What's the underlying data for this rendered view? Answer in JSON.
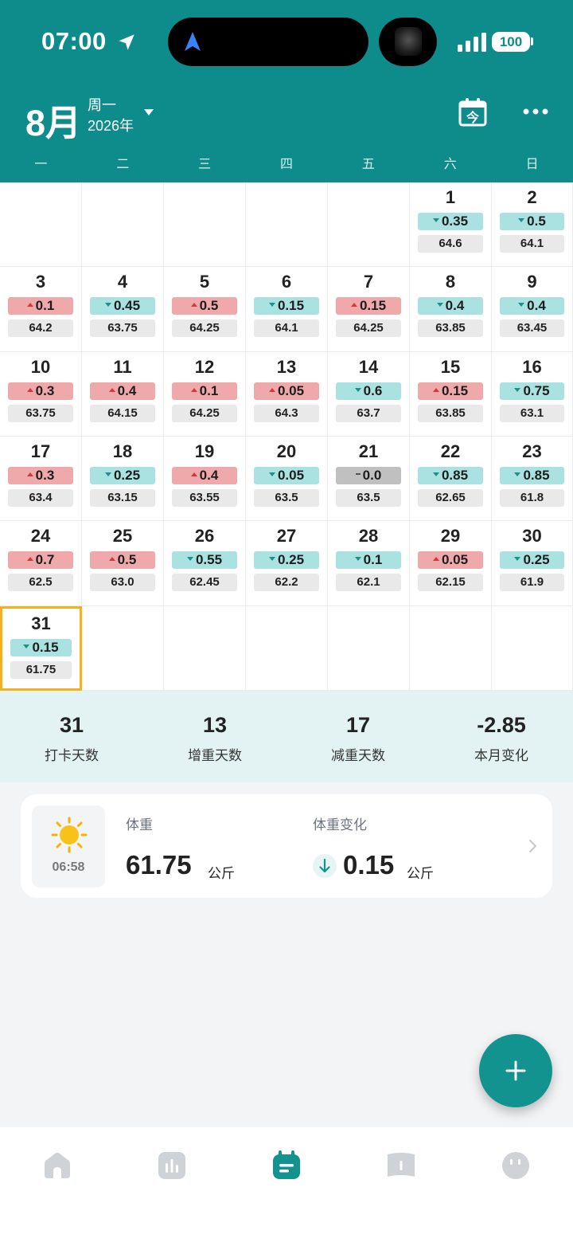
{
  "status_bar": {
    "time": "07:00",
    "battery": "100"
  },
  "header": {
    "month": "8月",
    "weekday": "周一",
    "year": "2026年",
    "weekdays": [
      "一",
      "二",
      "三",
      "四",
      "五",
      "六",
      "日"
    ]
  },
  "calendar": {
    "days": [
      {
        "day": "1",
        "change": "0.35",
        "dir": "down",
        "weight": "64.6"
      },
      {
        "day": "2",
        "change": "0.5",
        "dir": "down",
        "weight": "64.1"
      },
      {
        "day": "3",
        "change": "0.1",
        "dir": "up",
        "weight": "64.2"
      },
      {
        "day": "4",
        "change": "0.45",
        "dir": "down",
        "weight": "63.75"
      },
      {
        "day": "5",
        "change": "0.5",
        "dir": "up",
        "weight": "64.25"
      },
      {
        "day": "6",
        "change": "0.15",
        "dir": "down",
        "weight": "64.1"
      },
      {
        "day": "7",
        "change": "0.15",
        "dir": "up",
        "weight": "64.25"
      },
      {
        "day": "8",
        "change": "0.4",
        "dir": "down",
        "weight": "63.85"
      },
      {
        "day": "9",
        "change": "0.4",
        "dir": "down",
        "weight": "63.45"
      },
      {
        "day": "10",
        "change": "0.3",
        "dir": "up",
        "weight": "63.75"
      },
      {
        "day": "11",
        "change": "0.4",
        "dir": "up",
        "weight": "64.15"
      },
      {
        "day": "12",
        "change": "0.1",
        "dir": "up",
        "weight": "64.25"
      },
      {
        "day": "13",
        "change": "0.05",
        "dir": "up",
        "weight": "64.3"
      },
      {
        "day": "14",
        "change": "0.6",
        "dir": "down",
        "weight": "63.7"
      },
      {
        "day": "15",
        "change": "0.15",
        "dir": "up",
        "weight": "63.85"
      },
      {
        "day": "16",
        "change": "0.75",
        "dir": "down",
        "weight": "63.1"
      },
      {
        "day": "17",
        "change": "0.3",
        "dir": "up",
        "weight": "63.4"
      },
      {
        "day": "18",
        "change": "0.25",
        "dir": "down",
        "weight": "63.15"
      },
      {
        "day": "19",
        "change": "0.4",
        "dir": "up",
        "weight": "63.55"
      },
      {
        "day": "20",
        "change": "0.05",
        "dir": "down",
        "weight": "63.5"
      },
      {
        "day": "21",
        "change": "0.0",
        "dir": "flat",
        "weight": "63.5"
      },
      {
        "day": "22",
        "change": "0.85",
        "dir": "down",
        "weight": "62.65"
      },
      {
        "day": "23",
        "change": "0.85",
        "dir": "down",
        "weight": "61.8"
      },
      {
        "day": "24",
        "change": "0.7",
        "dir": "up",
        "weight": "62.5"
      },
      {
        "day": "25",
        "change": "0.5",
        "dir": "up",
        "weight": "63.0"
      },
      {
        "day": "26",
        "change": "0.55",
        "dir": "down",
        "weight": "62.45"
      },
      {
        "day": "27",
        "change": "0.25",
        "dir": "down",
        "weight": "62.2"
      },
      {
        "day": "28",
        "change": "0.1",
        "dir": "down",
        "weight": "62.1"
      },
      {
        "day": "29",
        "change": "0.05",
        "dir": "up",
        "weight": "62.15"
      },
      {
        "day": "30",
        "change": "0.25",
        "dir": "down",
        "weight": "61.9"
      },
      {
        "day": "31",
        "change": "0.15",
        "dir": "down",
        "weight": "61.75"
      }
    ],
    "selected_day": "31"
  },
  "stats": [
    {
      "value": "31",
      "label": "打卡天数"
    },
    {
      "value": "13",
      "label": "增重天数"
    },
    {
      "value": "17",
      "label": "减重天数"
    },
    {
      "value": "-2.85",
      "label": "本月变化"
    }
  ],
  "record": {
    "time": "06:58",
    "weight_label": "体重",
    "weight_value": "61.75",
    "weight_unit": "公斤",
    "change_label": "体重变化",
    "change_value": "0.15",
    "change_unit": "公斤"
  },
  "colors": {
    "brand": "#0e8b8b",
    "down": "#a9e2e1",
    "up": "#f0a9ab",
    "flat": "#c0c0c0",
    "selected_border": "#f3b21b"
  },
  "icons": [
    "location-arrow-icon",
    "navigation-icon",
    "calendar-today-icon",
    "more-icon",
    "sun-icon",
    "arrow-down-icon",
    "chevron-right-icon",
    "plus-icon",
    "home-icon",
    "chart-icon",
    "calendar-icon",
    "book-icon",
    "profile-icon"
  ]
}
